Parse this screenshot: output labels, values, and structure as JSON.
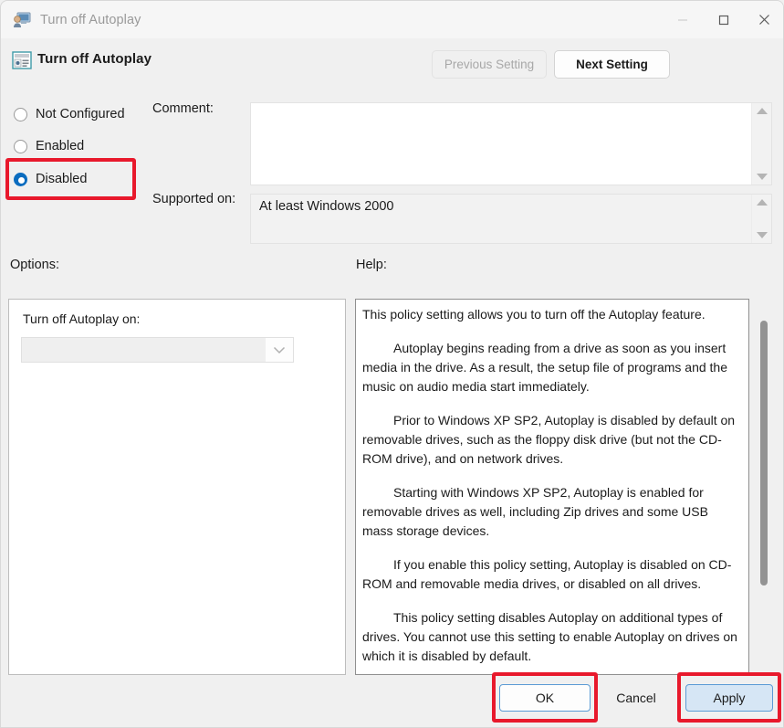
{
  "window": {
    "title": "Turn off Autoplay",
    "title_icon": "policy-monitor-icon",
    "minimize_icon": "minimize-icon",
    "maximize_icon": "maximize-icon",
    "close_icon": "close-icon"
  },
  "header": {
    "icon": "group-policy-setting-icon",
    "title": "Turn off Autoplay",
    "previous_setting_label": "Previous Setting",
    "next_setting_label": "Next Setting"
  },
  "state": {
    "options": [
      {
        "label": "Not Configured",
        "selected": false
      },
      {
        "label": "Enabled",
        "selected": false
      },
      {
        "label": "Disabled",
        "selected": true
      }
    ]
  },
  "comment": {
    "label": "Comment:",
    "value": "",
    "scroll_up_icon": "arrow-up-icon",
    "scroll_down_icon": "arrow-down-icon"
  },
  "supported_on": {
    "label": "Supported on:",
    "value": "At least Windows 2000",
    "scroll_up_icon": "arrow-up-icon",
    "scroll_down_icon": "arrow-down-icon"
  },
  "options_panel": {
    "section_label": "Options:",
    "field_label": "Turn off Autoplay on:",
    "dropdown_value": "",
    "dropdown_icon": "chevron-down-icon"
  },
  "help_panel": {
    "section_label": "Help:",
    "paragraphs": [
      "This policy setting allows you to turn off the Autoplay feature.",
      "Autoplay begins reading from a drive as soon as you insert media in the drive. As a result, the setup file of programs and the music on audio media start immediately.",
      "Prior to Windows XP SP2, Autoplay is disabled by default on removable drives, such as the floppy disk drive (but not the CD-ROM drive), and on network drives.",
      "Starting with Windows XP SP2, Autoplay is enabled for removable drives as well, including Zip drives and some USB mass storage devices.",
      "If you enable this policy setting, Autoplay is disabled on CD-ROM and removable media drives, or disabled on all drives.",
      "This policy setting disables Autoplay on additional types of drives. You cannot use this setting to enable Autoplay on drives on which it is disabled by default."
    ]
  },
  "footer": {
    "ok_label": "OK",
    "cancel_label": "Cancel",
    "apply_label": "Apply"
  },
  "annotations": {
    "highlight_color": "#e8192c",
    "highlighted": [
      "Disabled",
      "OK",
      "Apply"
    ]
  }
}
